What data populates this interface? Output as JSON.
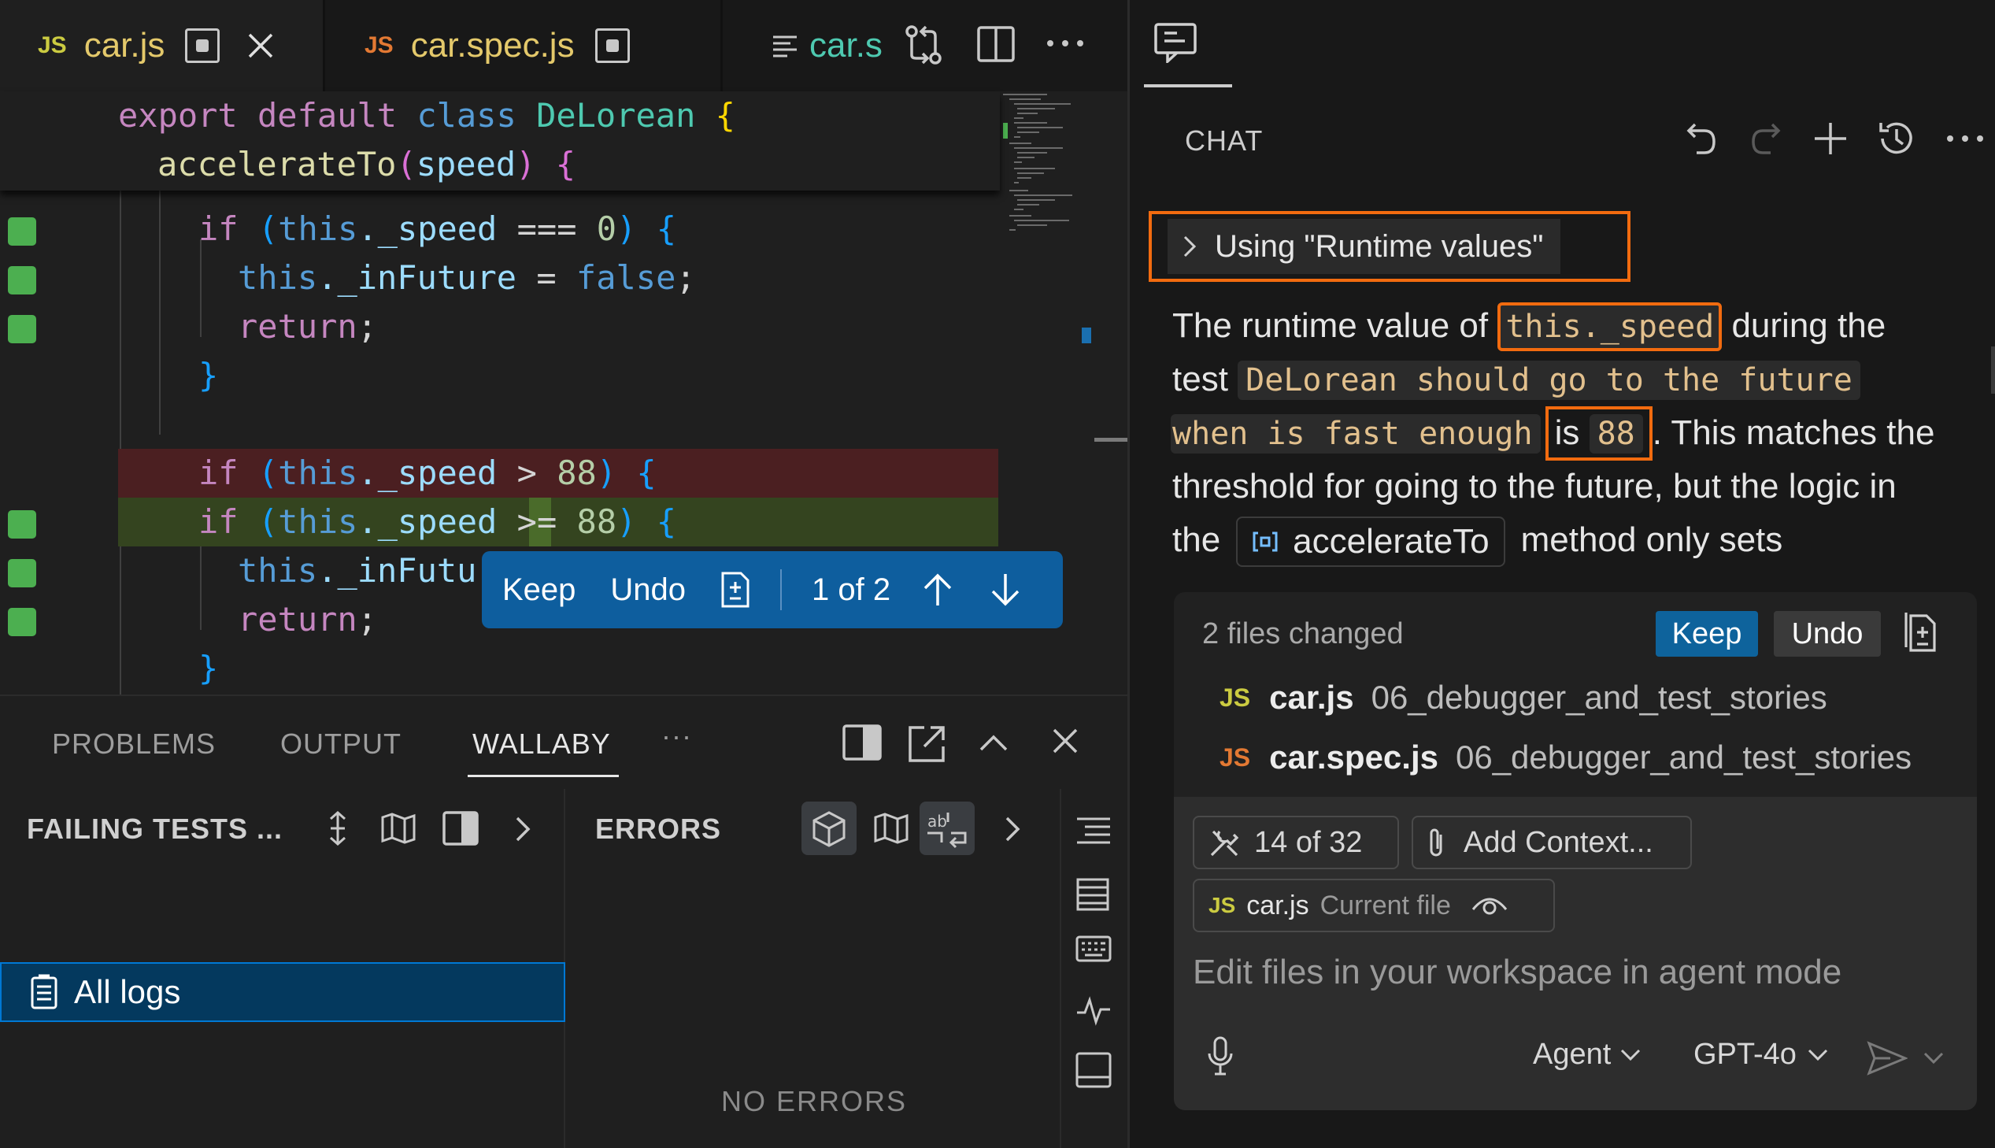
{
  "tabs": [
    {
      "badge": "JS",
      "name": "car.js"
    },
    {
      "badge": "JS",
      "name": "car.spec.js"
    },
    {
      "name": "car.s"
    }
  ],
  "sticky": {
    "line1": {
      "k1": "export",
      "k2": "default",
      "k3": "class",
      "cls": "DeLorean",
      "brace": "{"
    },
    "line2": {
      "fn": "accelerateTo",
      "open": "(",
      "param": "speed",
      "close": ")",
      "brace": "{"
    }
  },
  "code": {
    "l1": {
      "kw": "if",
      "open": "(",
      "obj": "this",
      "prop": "._speed",
      "op": "===",
      "num": "0",
      "close": ")",
      "brace": "{"
    },
    "l2": {
      "obj": "this",
      "prop": "._inFuture",
      "op": "=",
      "val": "false",
      "semi": ";"
    },
    "l3": {
      "kw": "return",
      "semi": ";"
    },
    "l4": {
      "brace": "}"
    },
    "l5": {
      "kw": "if",
      "open": "(",
      "obj": "this",
      "prop": "._speed",
      "op": ">",
      "num": "88",
      "close": ")",
      "brace": "{"
    },
    "l6": {
      "kw": "if",
      "open": "(",
      "obj": "this",
      "prop": "._speed",
      "op_a": ">",
      "op_b": "=",
      "num": "88",
      "close": ")",
      "brace": "{"
    },
    "l7": {
      "obj": "this",
      "prop": "._inFutur"
    },
    "l8": {
      "kw": "return",
      "semi": ";"
    },
    "l9": {
      "brace": "}"
    }
  },
  "keepbar": {
    "keep": "Keep",
    "undo": "Undo",
    "counter": "1 of 2"
  },
  "panel": {
    "tabs": {
      "problems": "PROBLEMS",
      "output": "OUTPUT",
      "wallaby": "WALLABY",
      "more": "···"
    },
    "failing_title": "FAILING TESTS ...",
    "all_logs": "All logs",
    "errors_title": "ERRORS",
    "no_errors": "NO ERRORS"
  },
  "chat": {
    "title": "CHAT",
    "using": "Using \"Runtime values\"",
    "p1": {
      "a": "The runtime value of ",
      "code": "this._speed",
      "b": " during the"
    },
    "p2": {
      "a": "test ",
      "code": "DeLorean should go to the future"
    },
    "p3": {
      "code": "when is fast enough",
      "is": "is",
      "num": "88",
      "dot": ".",
      "b": " This matches the"
    },
    "p4": {
      "a": "threshold for going to the future, but the logic in"
    },
    "p5": {
      "a": "the",
      "sym": "accelerateTo",
      "b": "method only sets"
    },
    "files_changed": "2 files changed",
    "keep": "Keep",
    "undo": "Undo",
    "files": [
      {
        "badge": "JS",
        "name": "car.js",
        "path": "06_debugger_and_test_stories"
      },
      {
        "badge": "JS",
        "name": "car.spec.js",
        "path": "06_debugger_and_test_stories"
      }
    ],
    "tools_count": "14 of 32",
    "add_context": "Add Context...",
    "current_file": {
      "badge": "JS",
      "name": "car.js",
      "label": "Current file"
    },
    "placeholder": "Edit files in your workspace in agent mode",
    "mode": "Agent",
    "model": "GPT-4o"
  },
  "colors": {
    "js_yellow": "#cbcb41",
    "js_orange": "#e37933",
    "accent_blue": "#0e639c",
    "highlight_orange": "#f26b0f",
    "gutter_added": "#4caf50"
  }
}
